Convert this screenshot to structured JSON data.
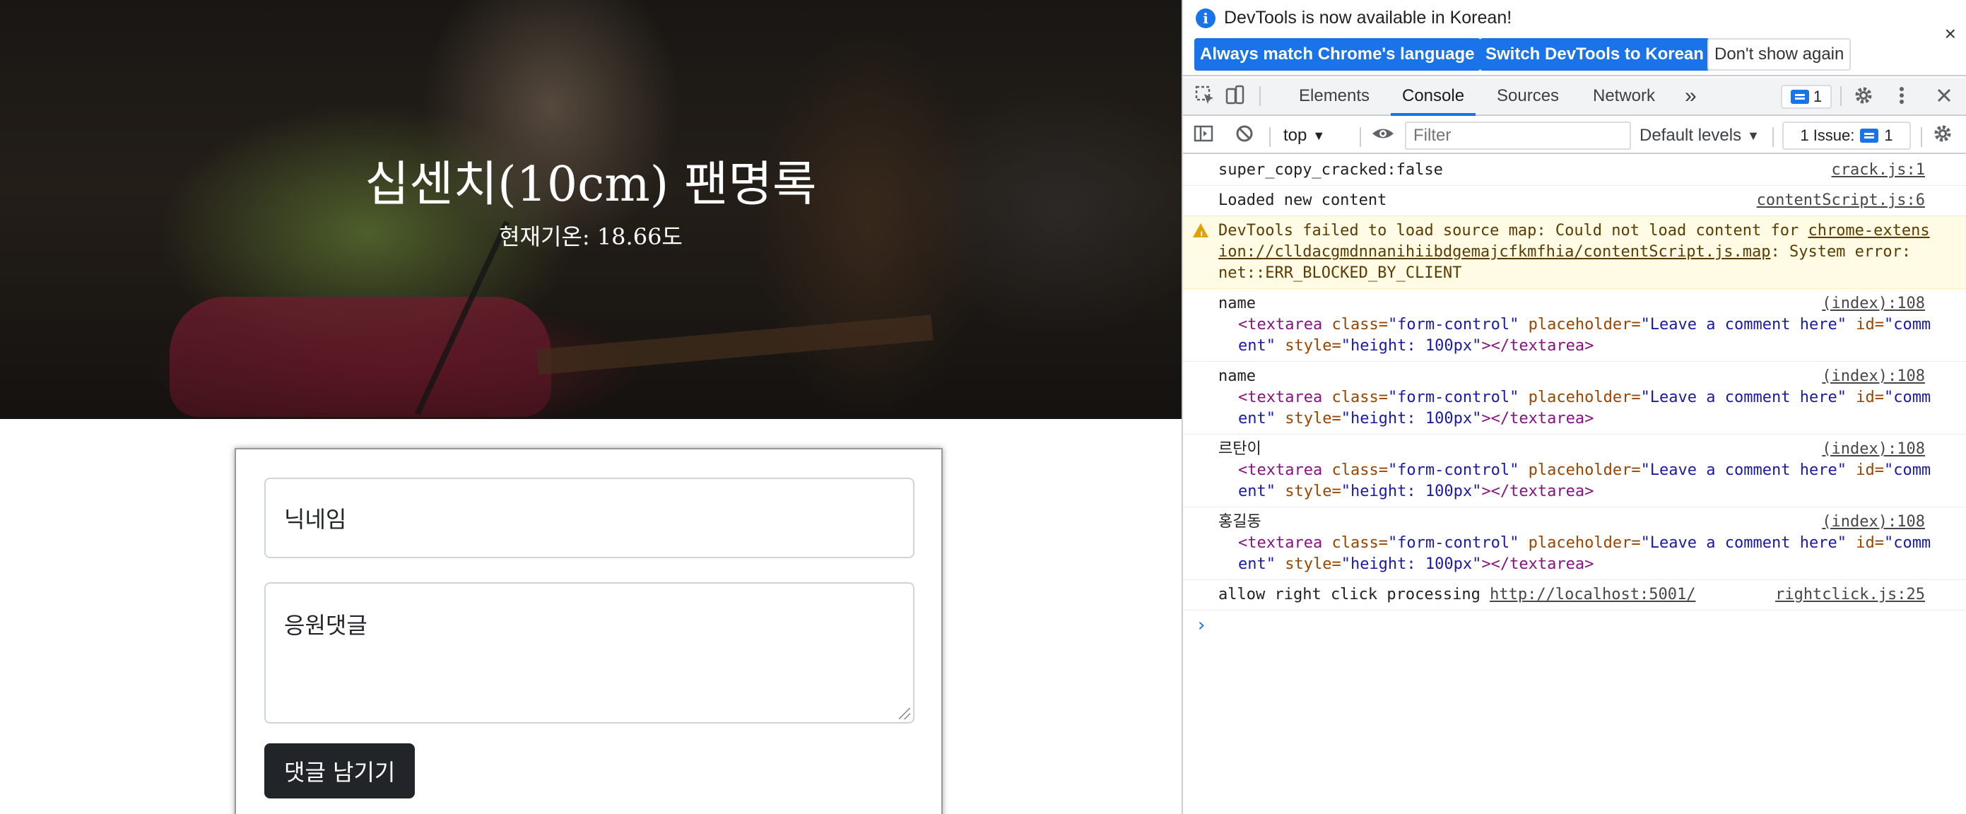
{
  "page": {
    "hero_title": "십센치(10cm) 팬명록",
    "hero_subtitle": "현재기온: 18.66도",
    "nickname_placeholder": "닉네임",
    "comment_placeholder": "응원댓글",
    "submit_label": "댓글 남기기"
  },
  "devtools": {
    "infobar": {
      "message": "DevTools is now available in Korean!",
      "btn_match": "Always match Chrome's language",
      "btn_switch": "Switch DevTools to Korean",
      "btn_dontshow": "Don't show again",
      "close": "×"
    },
    "tabs": [
      "Elements",
      "Console",
      "Sources",
      "Network"
    ],
    "more_tabs": "»",
    "message_count": "1",
    "toolbar": {
      "context": "top",
      "filter_placeholder": "Filter",
      "levels": "Default levels",
      "issues_label": "1 Issue:",
      "issues_count": "1"
    },
    "console": {
      "rows": [
        {
          "text": "super_copy_cracked:false",
          "source": "crack.js:1"
        },
        {
          "text": "Loaded new content",
          "source": "contentScript.js:6"
        }
      ],
      "warning": {
        "prefix": "DevTools failed to load source map: Could not load content for ",
        "link": "chrome-extension://clldacgmdnnanihiibdgemajcfkmfhia/contentScript.js.map",
        "suffix": ": System error: net::ERR_BLOCKED_BY_CLIENT"
      },
      "logs": [
        {
          "label": "name",
          "source": "(index):108"
        },
        {
          "label": "name",
          "source": "(index):108"
        },
        {
          "label": "르탄이",
          "source": "(index):108"
        },
        {
          "label": "홍길동",
          "source": "(index):108"
        }
      ],
      "html_node": {
        "tag_open": "<textarea",
        "class_attr": " class=",
        "class_val": "\"form-control\"",
        "ph_attr": " placeholder=",
        "ph_val": "\"Leave a comment here\"",
        "id_attr": " id=",
        "id_val": "\"comment\"",
        "style_attr": " style=",
        "style_val": "\"height: 100px\"",
        "tag_close": "></textarea>"
      },
      "last_row": {
        "text": "allow right click processing ",
        "link": "http://localhost:5001/",
        "source": "rightclick.js:25"
      },
      "prompt": "›"
    }
  }
}
